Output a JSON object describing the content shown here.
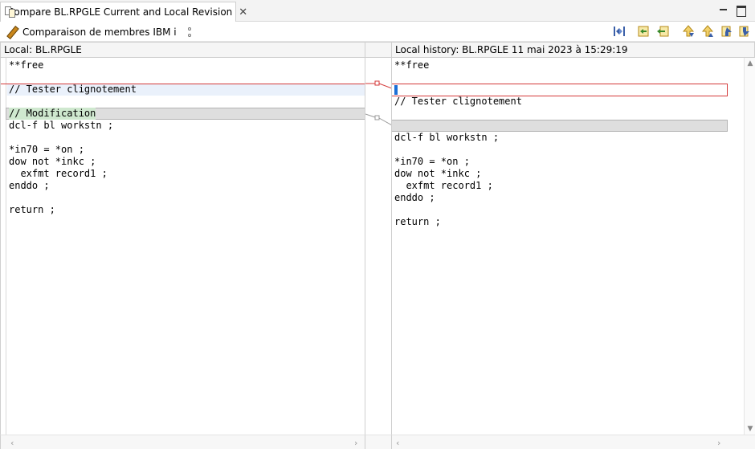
{
  "tab": {
    "title": "Compare BL.RPGLE Current and Local Revision",
    "close_glyph": "✕"
  },
  "toolbar": {
    "label": "Comparaison de membres IBM i",
    "icons": [
      "copy-all-from-right-to-left-icon",
      "copy-current-change-icon",
      "copy-right-to-left-icon",
      "next-difference-icon",
      "previous-difference-icon",
      "next-change-icon",
      "previous-change-icon"
    ]
  },
  "left": {
    "header": "Local: BL.RPGLE",
    "lines": [
      "**free",
      "",
      "// Tester clignotement",
      "",
      "// Modification",
      "dcl-f bl workstn ;",
      "",
      "*in70 = *on ;",
      "dow not *inkc ;",
      "  exfmt record1 ;",
      "enddo ;",
      "",
      "return ;"
    ]
  },
  "right": {
    "header": "Local history: BL.RPGLE 11 mai 2023 à 15:29:19",
    "lines": [
      "**free",
      "",
      "",
      "// Tester clignotement",
      "",
      "",
      "dcl-f bl workstn ;",
      "",
      "*in70 = *on ;",
      "dow not *inkc ;",
      "  exfmt record1 ;",
      "enddo ;",
      "",
      "return ;"
    ]
  },
  "colors": {
    "change_border": "#d43a3a",
    "caret": "#1c6fd6",
    "changed_bg": "#eaf1fb",
    "added_word_bg": "#cfe8cf"
  }
}
